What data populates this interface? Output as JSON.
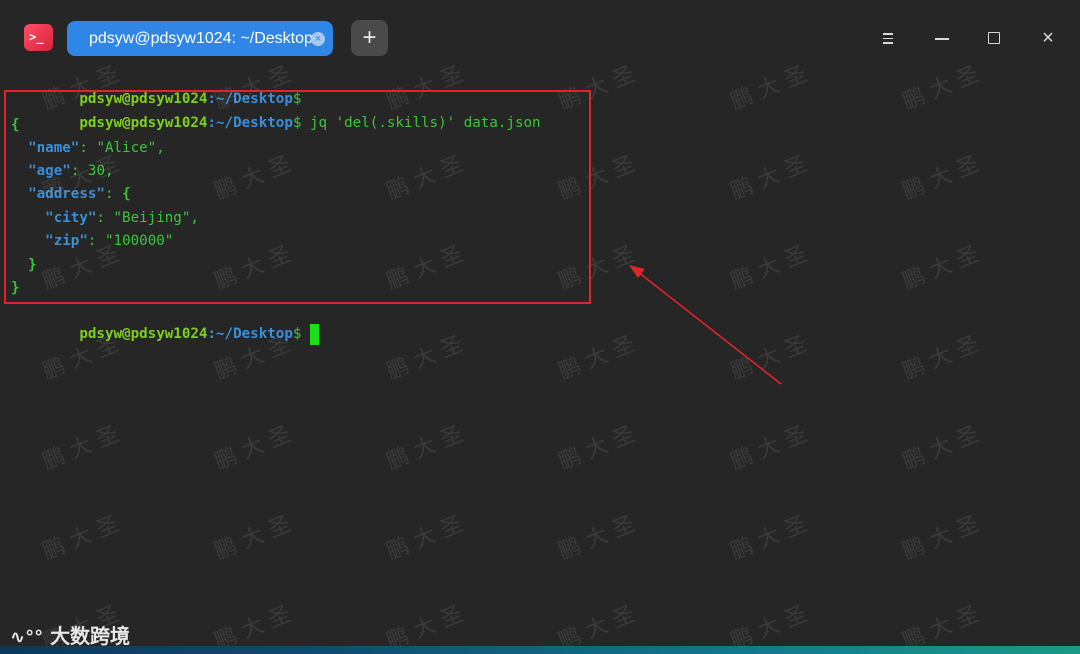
{
  "window": {
    "app_icon": ">_",
    "tab_title": "pdsyw@pdsyw1024: ~/Desktop",
    "tab_close": "×",
    "new_tab": "+",
    "controls": {
      "close": "×"
    }
  },
  "terminal": {
    "prompt_user": "pdsyw@pdsyw1024",
    "prompt_path": ":~/Desktop",
    "prompt_sym": "$",
    "command": " jq 'del(.skills)' data.json",
    "json_lines": [
      "{",
      "  \"name\": \"Alice\",",
      "  \"age\": 30,",
      "  \"address\": {",
      "    \"city\": \"Beijing\",",
      "    \"zip\": \"100000\"",
      "  }",
      "}"
    ],
    "keys": {
      "name": "\"name\"",
      "age": "\"age\"",
      "address": "\"address\"",
      "city": "\"city\"",
      "zip": "\"zip\""
    },
    "values": {
      "name": "\"Alice\"",
      "age": "30",
      "city": "\"Beijing\"",
      "zip": "\"100000\""
    }
  },
  "annotation": {
    "box_color": "#e0242c",
    "arrow_color": "#e0242c"
  },
  "branding": {
    "logo_text": "大数跨境",
    "watermark_text": "鹏 大 圣"
  }
}
